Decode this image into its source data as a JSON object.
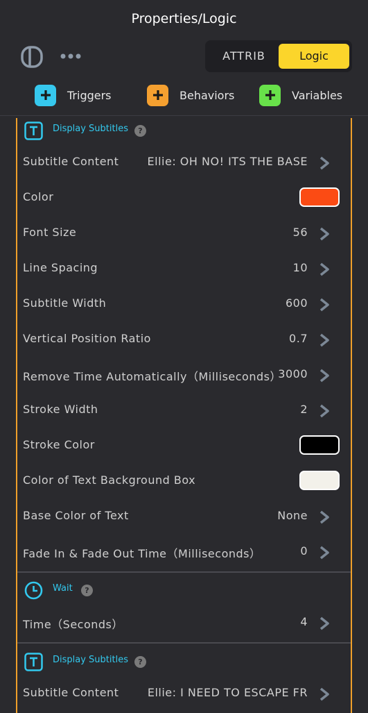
{
  "header": {
    "title": "Properties/Logic",
    "panel_icon": "sidebar-toggle-icon",
    "more_icon": "more-dots-icon",
    "tabs": {
      "attrib": "ATTRIB",
      "logic": "Logic",
      "active": "Logic"
    }
  },
  "add_buttons": [
    {
      "label": "Triggers",
      "color": "#36c8ee"
    },
    {
      "label": "Behaviors",
      "color": "#f5a030"
    },
    {
      "label": "Variables",
      "color": "#68e14a"
    }
  ],
  "blocks": {
    "subtitles1": {
      "name": "Display Subtitles",
      "icon": "text-icon",
      "help": "?",
      "rows": {
        "content": {
          "label": "Subtitle Content",
          "value": "Ellie: OH NO! ITS THE BASE"
        },
        "color": {
          "label": "Color",
          "swatch": "#fb4b14"
        },
        "font_size": {
          "label": "Font Size",
          "value": "56"
        },
        "line_spacing": {
          "label": "Line Spacing",
          "value": "10"
        },
        "width": {
          "label": "Subtitle Width",
          "value": "600"
        },
        "vpos": {
          "label": "Vertical Position Ratio",
          "value": "0.7"
        },
        "remove_time": {
          "label": "Remove Time Automatically（Milliseconds）",
          "value": "3000"
        },
        "stroke_width": {
          "label": "Stroke Width",
          "value": "2"
        },
        "stroke_color": {
          "label": "Stroke Color",
          "swatch": "#000000"
        },
        "bg_box": {
          "label": "Color of Text Background Box",
          "swatch": "#f3f1ea"
        },
        "base_color": {
          "label": "Base Color of Text",
          "value": "None"
        },
        "fade": {
          "label": "Fade In & Fade Out Time（Milliseconds）",
          "value": "0"
        }
      }
    },
    "wait": {
      "name": "Wait",
      "icon": "clock-icon",
      "help": "?",
      "rows": {
        "time": {
          "label": "Time（Seconds）",
          "value": "4"
        }
      }
    },
    "subtitles2": {
      "name": "Display Subtitles",
      "icon": "text-icon",
      "help": "?",
      "rows": {
        "content": {
          "label": "Subtitle Content",
          "value": "Ellie: I NEED TO ESCAPE FR"
        }
      }
    }
  },
  "colors": {
    "accent_border": "#f0a02a",
    "block_name": "#33c9ee",
    "logic_tab": "#fbd52b"
  }
}
